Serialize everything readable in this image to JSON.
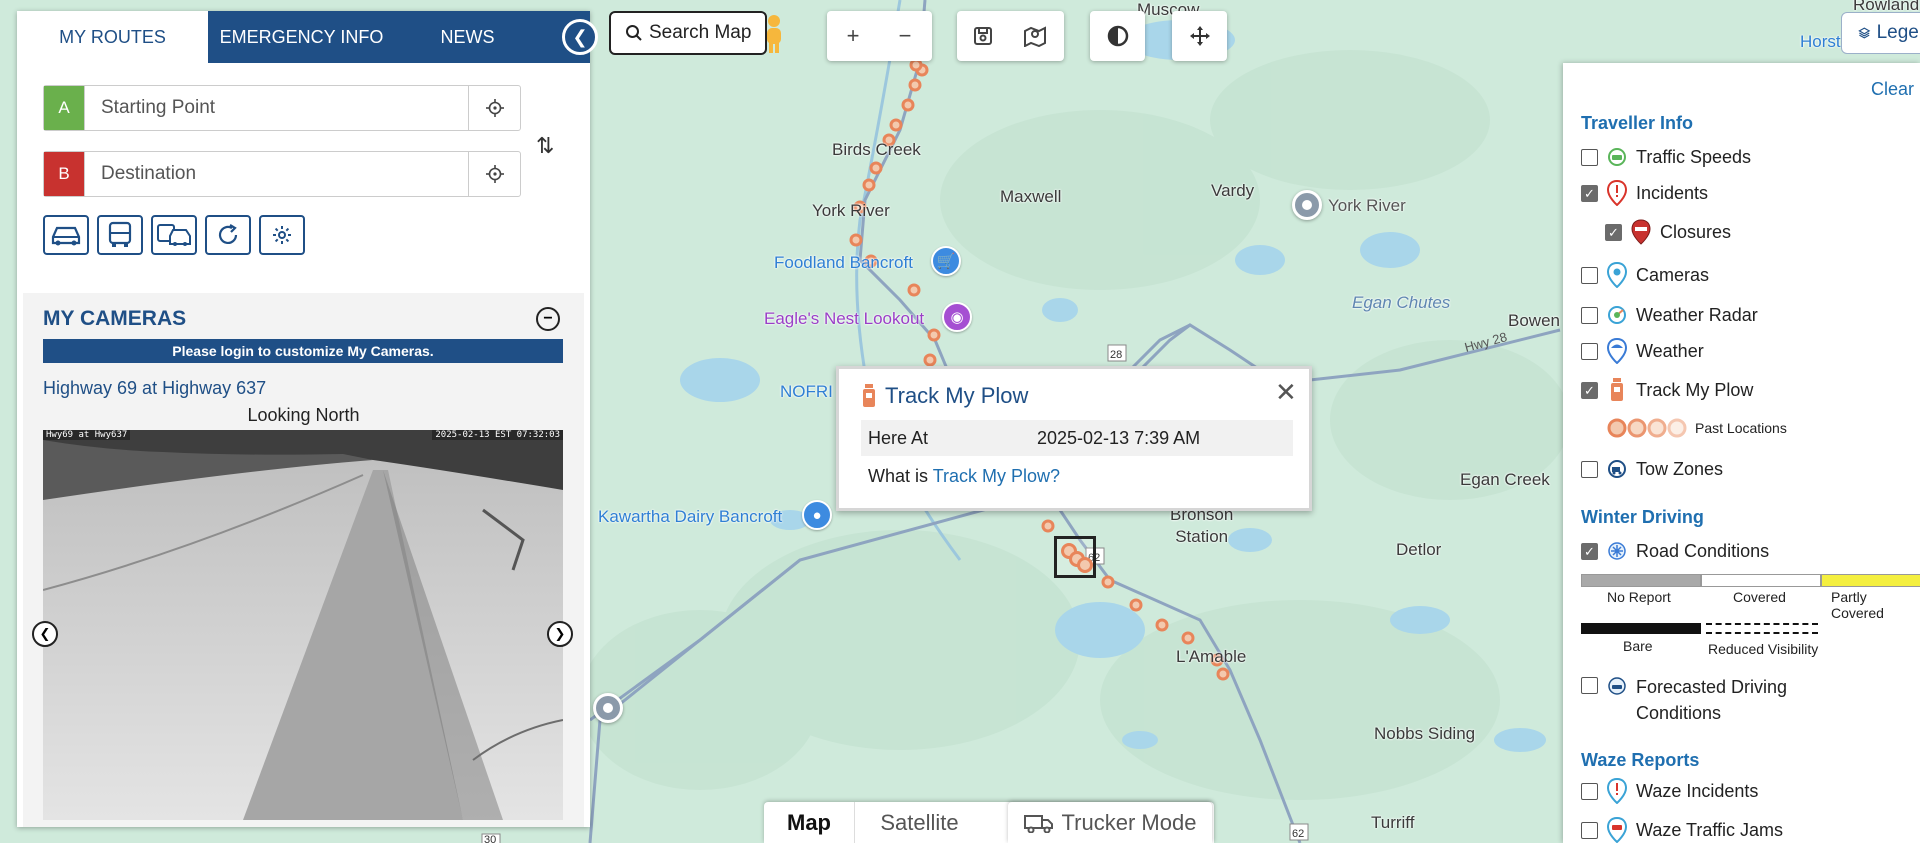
{
  "tabs": [
    {
      "label": "MY ROUTES",
      "active": true
    },
    {
      "label": "EMERGENCY INFO",
      "active": false
    },
    {
      "label": "NEWS",
      "active": false
    }
  ],
  "route": {
    "start_letter": "A",
    "start_placeholder": "Starting Point",
    "dest_letter": "B",
    "dest_placeholder": "Destination"
  },
  "my_cameras": {
    "heading": "MY CAMERAS",
    "login_notice": "Please login to customize My Cameras.",
    "camera_title": "Highway 69 at Highway 637",
    "direction": "Looking North",
    "stamp_left": "Hwy69 at Hwy637",
    "stamp_right": "2025-02-13 EST 07:32:03"
  },
  "map_controls": {
    "search_label": "Search Map",
    "legend_label": "Legend"
  },
  "map_labels": {
    "birds_creek": "Birds Creek",
    "york_river_town": "York River",
    "maxwell": "Maxwell",
    "vardy": "Vardy",
    "york_river_pin": "York River",
    "foodland": "Foodland Bancroft",
    "eagles_nest": "Eagle's Nest Lookout",
    "egan_chutes": "Egan Chutes",
    "bowen": "Bowen",
    "nofri": "NOFRI",
    "kawartha": "Kawartha Dairy Bancroft",
    "egan_creek": "Egan Creek",
    "bronson_station": "Bronson\nStation",
    "detlor": "Detlor",
    "lamable": "L'Amable",
    "nobbs_siding": "Nobbs Siding",
    "turriff": "Turriff",
    "muscow": "Muscow",
    "horst": "Horst",
    "rowland": "Rowland",
    "hwy28": "Hwy 28",
    "route_28": "28",
    "route_62": "62",
    "route_62b": "62",
    "route_30": "30"
  },
  "popup": {
    "title": "Track My Plow",
    "here_at_label": "Here At",
    "here_at_value": "2025-02-13 7:39 AM",
    "what_is_prefix": "What is ",
    "what_is_link": "Track My Plow?"
  },
  "map_type": {
    "map": "Map",
    "satellite": "Satellite",
    "trucker_mode": "Trucker Mode"
  },
  "legend_panel": {
    "clear_label": "Clear",
    "traveller_info_heading": "Traveller Info",
    "layers": [
      {
        "label": "Traffic Speeds",
        "checked": false
      },
      {
        "label": "Incidents",
        "checked": true
      },
      {
        "label": "Closures",
        "checked": true
      },
      {
        "label": "Cameras",
        "checked": false
      },
      {
        "label": "Weather Radar",
        "checked": false
      },
      {
        "label": "Weather",
        "checked": false
      },
      {
        "label": "Track My Plow",
        "checked": true
      },
      {
        "label": "Tow Zones",
        "checked": false
      }
    ],
    "past_locations_label": "Past Locations",
    "winter_driving_heading": "Winter Driving",
    "road_conditions_label": "Road Conditions",
    "road_conditions_checked": true,
    "rc_no_report": "No Report",
    "rc_covered": "Covered",
    "rc_partly_covered": "Partly Covered",
    "rc_bare": "Bare",
    "rc_reduced_visibility": "Reduced Visibility",
    "forecasted_label_1": "Forecasted Driving",
    "forecasted_label_2": "Conditions",
    "forecasted_checked": false,
    "waze_heading": "Waze Reports",
    "waze_incidents_label": "Waze Incidents",
    "waze_incidents_checked": false,
    "waze_jams_label": "Waze Traffic Jams",
    "waze_jams_checked": false
  },
  "colors": {
    "brand_blue": "#1f4f86",
    "start_green": "#6ab04c",
    "dest_red": "#c8322f",
    "plow_orange": "#e8855a",
    "map_green": "#cfeadb",
    "water_blue": "#a9d6ea"
  }
}
